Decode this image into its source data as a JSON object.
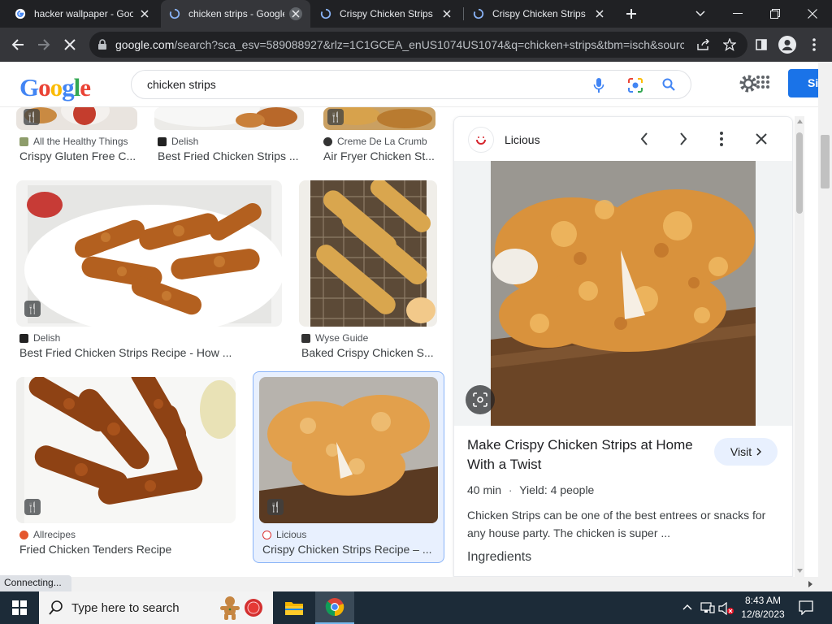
{
  "tabs": [
    {
      "title": "hacker wallpaper - Goo",
      "active": false,
      "favicon": "google-icon"
    },
    {
      "title": "chicken strips - Google",
      "active": true,
      "favicon": "loading-icon"
    },
    {
      "title": "Crispy Chicken Strips R",
      "active": false,
      "favicon": "loading-icon"
    },
    {
      "title": "Crispy Chicken Strips R",
      "active": false,
      "favicon": "loading-icon"
    }
  ],
  "address_bar": {
    "host": "google.com",
    "path": "/search?sca_esv=589088927&rlz=1C1GCEA_enUS1074US1074&q=chicken+strips&tbm=isch&sourc..."
  },
  "google": {
    "logo_text": "Google",
    "query": "chicken strips",
    "signin_label": "Si"
  },
  "results": [
    {
      "source": "All the Healthy Things",
      "title": "Crispy Gluten Free C..."
    },
    {
      "source": "Delish",
      "title": "Best Fried Chicken Strips ..."
    },
    {
      "source": "Creme De La Crumb",
      "title": "Air Fryer Chicken St..."
    },
    {
      "source": "Delish",
      "title": "Best Fried Chicken Strips Recipe - How ..."
    },
    {
      "source": "Wyse Guide",
      "title": "Baked Crispy Chicken S..."
    },
    {
      "source": "Allrecipes",
      "title": "Fried Chicken Tenders Recipe"
    },
    {
      "source": "Licious",
      "title": "Crispy Chicken Strips Recipe – ..."
    }
  ],
  "panel": {
    "source": "Licious",
    "title": "Make Crispy Chicken Strips at Home With a Twist",
    "visit_label": "Visit",
    "time": "40 min",
    "yield": "Yield: 4 people",
    "description": "Chicken Strips can be one of the best entrees or snacks for any house party. The chicken is super ...",
    "section": "Ingredients"
  },
  "status_text": "Connecting...",
  "taskbar": {
    "search_placeholder": "Type here to search",
    "time": "8:43 AM",
    "date": "12/8/2023"
  },
  "colors": {
    "google_blue": "#4285f4",
    "google_red": "#ea4335",
    "google_yellow": "#fbbc05",
    "google_green": "#34a853",
    "selected_border": "#8ab4f8"
  }
}
